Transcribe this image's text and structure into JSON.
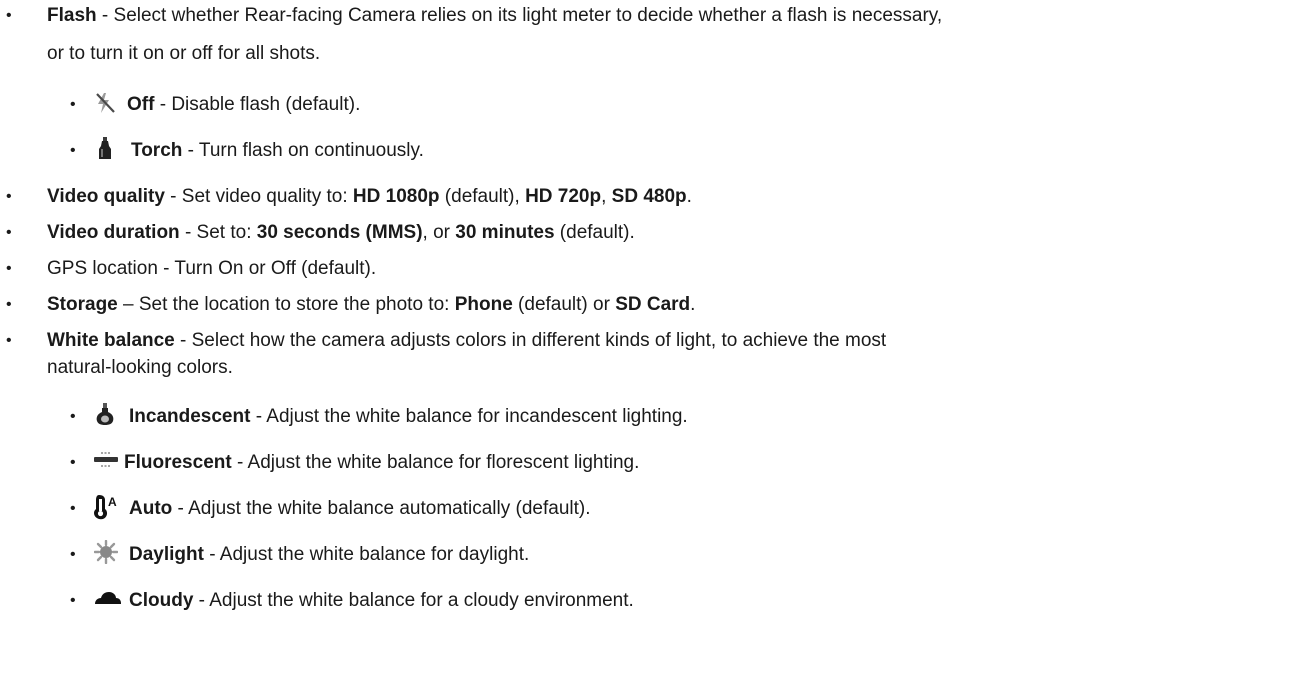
{
  "items": {
    "flash": {
      "bullet": "•",
      "label": "Flash",
      "sep": " - ",
      "desc1": "Select whether Rear-facing Camera relies on its light meter to decide whether a flash is necessary,",
      "desc2": "or to turn it on or off for all shots.",
      "sub": {
        "off": {
          "bullet": "•",
          "icon": "flash-off-icon",
          "label": "Off",
          "desc": " - Disable flash (default)."
        },
        "torch": {
          "bullet": "•",
          "icon": "torch-icon",
          "label": "Torch",
          "desc": " - Turn flash on continuously."
        }
      }
    },
    "video_quality": {
      "bullet": "•",
      "label": "Video quality",
      "pre": " - Set video quality to: ",
      "opt1": "HD 1080p",
      "mid1": " (default), ",
      "opt2": "HD 720p",
      "mid2": ", ",
      "opt3": "SD 480p",
      "end": "."
    },
    "video_duration": {
      "bullet": "•",
      "label": "Video duration",
      "pre": " - Set to: ",
      "opt1": "30 seconds (MMS)",
      "mid": ", or ",
      "opt2": "30 minutes",
      "end": " (default)."
    },
    "gps": {
      "bullet": "•",
      "text": "GPS location - Turn On or Off (default)."
    },
    "storage": {
      "bullet": "•",
      "label": "Storage",
      "pre": " – Set the location to store the photo to: ",
      "opt1": "Phone",
      "mid": " (default) or ",
      "opt2": "SD Card",
      "end": "."
    },
    "white_balance": {
      "bullet": "•",
      "label": "White balance",
      "desc1": " - Select how the camera adjusts colors in different kinds of light, to achieve the most",
      "desc2": "natural-looking colors.",
      "sub": {
        "incandescent": {
          "bullet": "•",
          "icon": "incandescent-icon",
          "label": "Incandescent",
          "desc": " - Adjust the white balance for incandescent lighting."
        },
        "fluorescent": {
          "bullet": "•",
          "icon": "fluorescent-icon",
          "label": "Fluorescent",
          "desc": " - Adjust the white balance for florescent lighting."
        },
        "auto": {
          "bullet": "•",
          "icon": "auto-wb-icon",
          "label": "Auto",
          "desc": " - Adjust the white balance automatically (default)."
        },
        "daylight": {
          "bullet": "•",
          "icon": "daylight-icon",
          "label": "Daylight",
          "desc": " - Adjust the white balance for daylight."
        },
        "cloudy": {
          "bullet": "•",
          "icon": "cloudy-icon",
          "label": "Cloudy",
          "desc": " - Adjust the white balance for a cloudy environment."
        }
      }
    }
  }
}
